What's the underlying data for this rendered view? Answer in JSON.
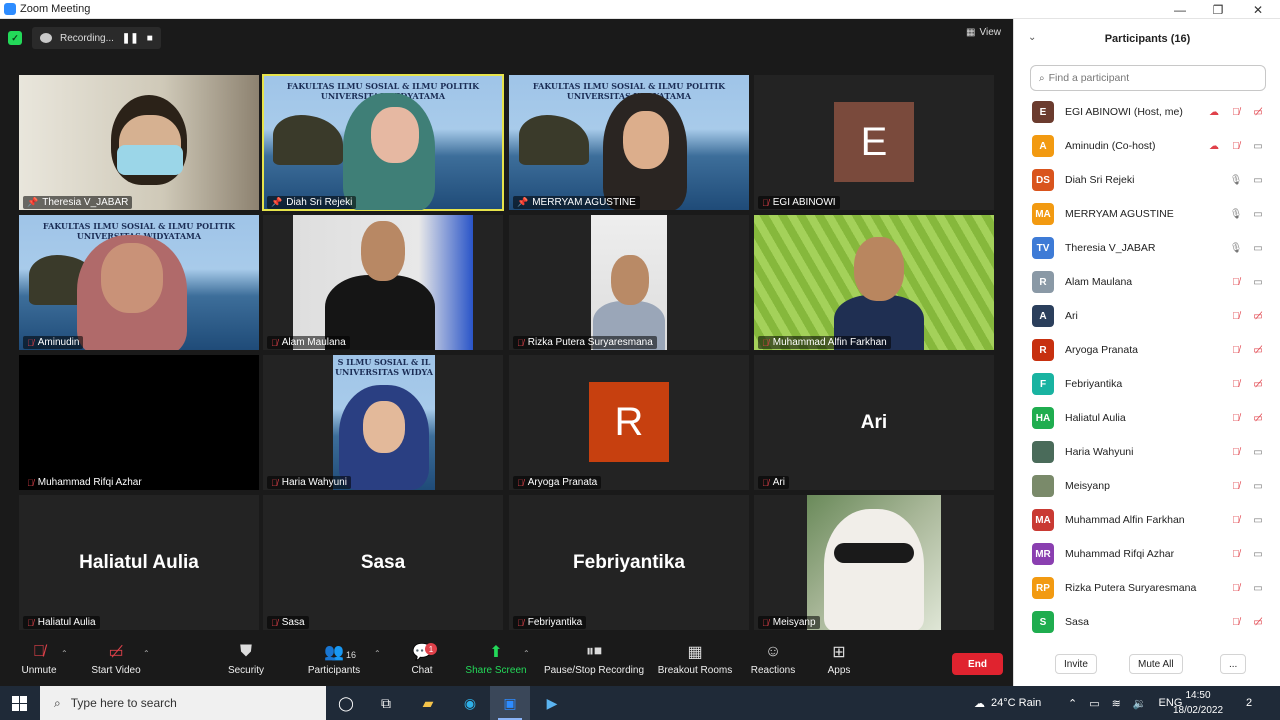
{
  "window": {
    "title": "Zoom Meeting"
  },
  "topbar": {
    "recording_label": "Recording...",
    "pause_glyph": "❚❚",
    "stop_glyph": "■",
    "view_label": "View"
  },
  "tiles": [
    {
      "name": "Theresia V_JABAR",
      "icon": "pin-icon",
      "kind": "video"
    },
    {
      "name": "Diah Sri Rejeki",
      "icon": "pin-icon",
      "kind": "video"
    },
    {
      "name": "MERRYAM AGUSTINE",
      "icon": "pin-icon",
      "kind": "video"
    },
    {
      "name": "EGI ABINOWI",
      "icon": "mic-off-icon",
      "kind": "avatar",
      "initial": "E",
      "color": "#7a4a3c"
    },
    {
      "name": "Aminudin",
      "icon": "mic-off-icon",
      "kind": "video"
    },
    {
      "name": "Alam Maulana",
      "icon": "mic-off-icon",
      "kind": "video"
    },
    {
      "name": "Rizka Putera Suryaresmana",
      "icon": "mic-off-icon",
      "kind": "video"
    },
    {
      "name": "Muhammad Alfin Farkhan",
      "icon": "mic-off-icon",
      "kind": "video"
    },
    {
      "name": "Muhammad Rifqi Azhar",
      "icon": "mic-off-icon",
      "kind": "black"
    },
    {
      "name": "Haria Wahyuni",
      "icon": "mic-off-icon",
      "kind": "video"
    },
    {
      "name": "Aryoga Pranata",
      "icon": "mic-off-icon",
      "kind": "avatar",
      "initial": "R",
      "color": "#c7400f"
    },
    {
      "name": "Ari",
      "icon": "mic-off-icon",
      "kind": "name",
      "bigname": "Ari"
    },
    {
      "name": "Haliatul Aulia",
      "icon": "mic-off-icon",
      "kind": "name",
      "bigname": "Haliatul Aulia"
    },
    {
      "name": "Sasa",
      "icon": "mic-off-icon",
      "kind": "name",
      "bigname": "Sasa"
    },
    {
      "name": "Febriyantika",
      "icon": "mic-off-icon",
      "kind": "name",
      "bigname": "Febriyantika"
    },
    {
      "name": "Meisyanp",
      "icon": "mic-off-icon",
      "kind": "video"
    }
  ],
  "banners": {
    "full": "FAKULTAS ILMU SOSIAL & ILMU POLITIK",
    "uni": "UNIVERSITAS WIDYATAMA",
    "short": "S ILMU SOSIAL & IL",
    "short_uni": "UNIVERSITAS WIDYA"
  },
  "panel": {
    "title": "Participants (16)",
    "search_placeholder": "Find a participant",
    "participants": [
      {
        "name": "EGI ABINOWI (Host, me)",
        "initials": "E",
        "color": "#6b3b2e",
        "rec": true,
        "mic": "off",
        "cam": "off"
      },
      {
        "name": "Aminudin (Co-host)",
        "initials": "A",
        "color": "#f29a11",
        "rec": true,
        "mic": "off",
        "cam": "on"
      },
      {
        "name": "Diah Sri Rejeki",
        "initials": "DS",
        "color": "#d9541d",
        "rec": false,
        "mic": "on",
        "cam": "on"
      },
      {
        "name": "MERRYAM AGUSTINE",
        "initials": "MA",
        "color": "#f29a11",
        "rec": false,
        "mic": "on",
        "cam": "on"
      },
      {
        "name": "Theresia V_JABAR",
        "initials": "TV",
        "color": "#3e7bd6",
        "rec": false,
        "mic": "on",
        "cam": "on"
      },
      {
        "name": "Alam Maulana",
        "initials": "R",
        "color": "#8a99a6",
        "rec": false,
        "mic": "off",
        "cam": "on"
      },
      {
        "name": "Ari",
        "initials": "A",
        "color": "#2b3f5c",
        "rec": false,
        "mic": "off",
        "cam": "off"
      },
      {
        "name": "Aryoga Pranata",
        "initials": "R",
        "color": "#c7300f",
        "rec": false,
        "mic": "off",
        "cam": "off"
      },
      {
        "name": "Febriyantika",
        "initials": "F",
        "color": "#19b3a1",
        "rec": false,
        "mic": "off",
        "cam": "off"
      },
      {
        "name": "Haliatul Aulia",
        "initials": "HA",
        "color": "#1fad4f",
        "rec": false,
        "mic": "off",
        "cam": "off"
      },
      {
        "name": "Haria Wahyuni",
        "initials": "",
        "color": "#4a6b5a",
        "rec": false,
        "mic": "off",
        "cam": "on"
      },
      {
        "name": "Meisyanp",
        "initials": "",
        "color": "#7a8a6a",
        "rec": false,
        "mic": "off",
        "cam": "on"
      },
      {
        "name": "Muhammad Alfin Farkhan",
        "initials": "MA",
        "color": "#c93a33",
        "rec": false,
        "mic": "off",
        "cam": "on"
      },
      {
        "name": "Muhammad Rifqi Azhar",
        "initials": "MR",
        "color": "#8a3fb0",
        "rec": false,
        "mic": "off",
        "cam": "on"
      },
      {
        "name": "Rizka Putera Suryaresmana",
        "initials": "RP",
        "color": "#f29a11",
        "rec": false,
        "mic": "off",
        "cam": "on"
      },
      {
        "name": "Sasa",
        "initials": "S",
        "color": "#1fad4f",
        "rec": false,
        "mic": "off",
        "cam": "off"
      }
    ],
    "invite_label": "Invite",
    "mute_all_label": "Mute All",
    "more_label": "..."
  },
  "toolbar": {
    "unmute": "Unmute",
    "start_video": "Start Video",
    "security": "Security",
    "participants": "Participants",
    "participants_count": "16",
    "chat": "Chat",
    "chat_badge": "1",
    "share_screen": "Share Screen",
    "pause_stop": "Pause/Stop Recording",
    "breakout": "Breakout Rooms",
    "reactions": "Reactions",
    "apps": "Apps",
    "end": "End"
  },
  "taskbar": {
    "search_placeholder": "Type here to search",
    "weather": "24°C  Rain",
    "lang": "ENG",
    "time": "14:50",
    "date": "18/02/2022",
    "notif_count": "2"
  }
}
